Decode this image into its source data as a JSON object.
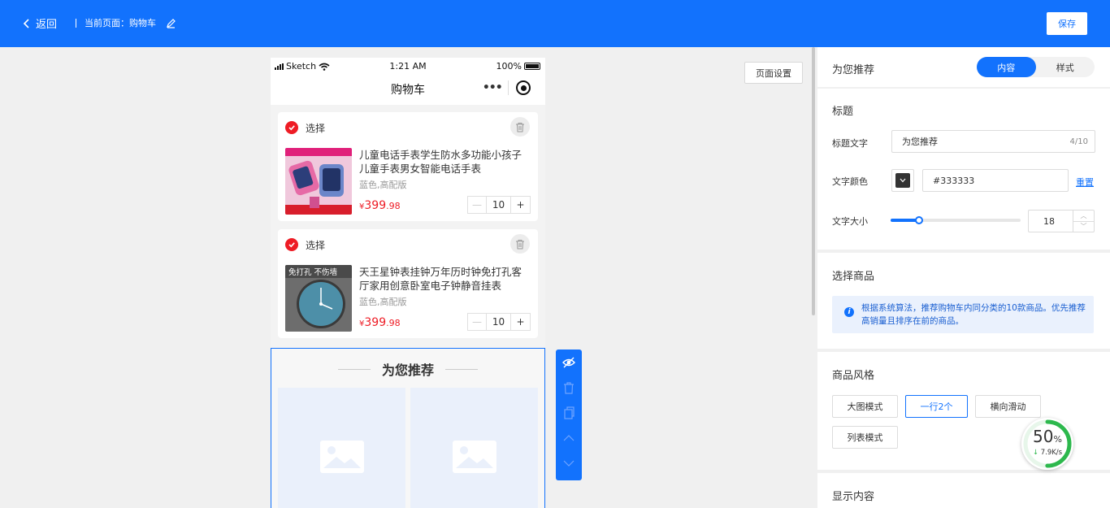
{
  "topbar": {
    "back_label": "返回",
    "current_page": "当前页面：购物车",
    "save_label": "保存"
  },
  "canvas": {
    "page_settings_label": "页面设置"
  },
  "phone": {
    "carrier": "Sketch",
    "time": "1:21 AM",
    "battery": "100%",
    "nav_title": "购物车",
    "more_glyph": "•••"
  },
  "cart": {
    "select_label": "选择",
    "items": [
      {
        "name": "儿童电话手表学生防水多功能小孩子儿童手表男女智能电话手表",
        "spec": "蓝色,高配版",
        "currency": "¥",
        "price_int": "399",
        "price_dec": ".98",
        "qty": "10"
      },
      {
        "name": "天王星钟表挂钟万年历时钟免打孔客厅家用创意卧室电子钟静音挂表",
        "spec": "蓝色,高配版",
        "currency": "¥",
        "price_int": "399",
        "price_dec": ".98",
        "qty": "10",
        "thumb_text": "免打孔 不伤墙"
      }
    ],
    "minus": "—",
    "plus": "+"
  },
  "recommend": {
    "title": "为您推荐"
  },
  "panel": {
    "header_title": "为您推荐",
    "tabs": [
      {
        "label": "内容",
        "active": true
      },
      {
        "label": "样式",
        "active": false
      }
    ],
    "title_section": {
      "heading": "标题",
      "title_text_label": "标题文字",
      "title_text_value": "为您推荐",
      "title_text_count": "4/10",
      "color_label": "文字颜色",
      "color_value": "#333333",
      "reset_label": "重置",
      "size_label": "文字大小",
      "size_value": "18",
      "size_slider_fraction": 0.22
    },
    "goods_section": {
      "heading": "选择商品",
      "info_text": "根据系统算法，推荐购物车内同分类的10款商品。优先推荐高销量且排序在前的商品。"
    },
    "style_section": {
      "heading": "商品风格",
      "options": [
        {
          "label": "大图模式",
          "active": false
        },
        {
          "label": "一行2个",
          "active": true
        },
        {
          "label": "横向滑动",
          "active": false
        },
        {
          "label": "列表模式",
          "active": false
        }
      ]
    },
    "show_section": {
      "heading": "显示内容"
    }
  },
  "speed_widget": {
    "percent": "50",
    "percent_sign": "%",
    "rate": "7.9K/s",
    "progress": 0.5
  },
  "colors": {
    "brand": "#1272fd",
    "price": "#ee1c25",
    "check": "#ee1c25",
    "ring": "#2db84d"
  }
}
